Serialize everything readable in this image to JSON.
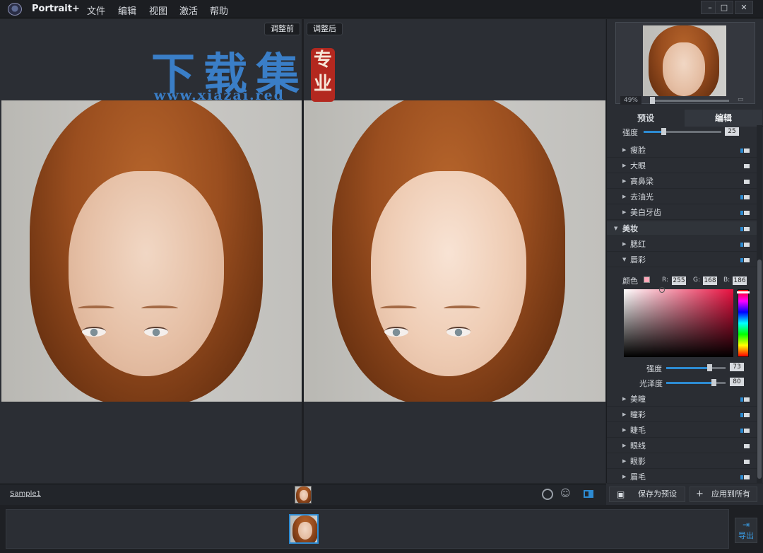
{
  "titlebar": {
    "app_name": "Portrait+",
    "menu": [
      "文件",
      "编辑",
      "视图",
      "激活",
      "帮助"
    ],
    "window_controls": [
      "minimize-icon",
      "maximize-icon",
      "close-icon"
    ]
  },
  "canvas": {
    "before_label": "调整前",
    "after_label": "调整后"
  },
  "watermark": {
    "big_text": "下载集",
    "seal_text": "专业",
    "url": "www.xiazai.red"
  },
  "navigator": {
    "zoom_text": "49%"
  },
  "tabs": {
    "preset": "预设",
    "edit": "编辑",
    "active": "edit"
  },
  "panel": {
    "strength_label": "强度",
    "strength_value": "25",
    "strength_fraction": 0.25,
    "items_top": [
      {
        "label": "瘦脸",
        "on": true
      },
      {
        "label": "大眼",
        "on": false
      },
      {
        "label": "高鼻梁",
        "on": false
      },
      {
        "label": "去油光",
        "on": true
      },
      {
        "label": "美白牙齿",
        "on": true
      }
    ],
    "makeup": {
      "label": "美妆",
      "on": true
    },
    "blush": {
      "label": "腮红",
      "on": true
    },
    "lip": {
      "label": "唇彩",
      "on": true
    },
    "color_label": "颜色",
    "swatch_color": "#ffa8ba",
    "r_label": "R:",
    "g_label": "G:",
    "b_label": "B:",
    "r": "255",
    "g": "168",
    "b": "186",
    "lip_strength_label": "强度",
    "lip_strength_value": "73",
    "lip_strength_fraction": 0.73,
    "gloss_label": "光泽度",
    "gloss_value": "80",
    "gloss_fraction": 0.8,
    "items_bottom": [
      {
        "label": "美瞳",
        "on": true
      },
      {
        "label": "瞳彩",
        "on": true
      },
      {
        "label": "睫毛",
        "on": true
      },
      {
        "label": "眼线",
        "on": false
      },
      {
        "label": "眼影",
        "on": false
      },
      {
        "label": "眉毛",
        "on": true
      }
    ]
  },
  "bottom": {
    "sample_label": "Sample1",
    "save_preset": "保存为预设",
    "apply_all": "应用到所有",
    "export_label": "导出"
  },
  "colors": {
    "accent": "#2d8bd2",
    "watermark_blue": "#3a7ec7",
    "seal_red": "#b3281f"
  }
}
